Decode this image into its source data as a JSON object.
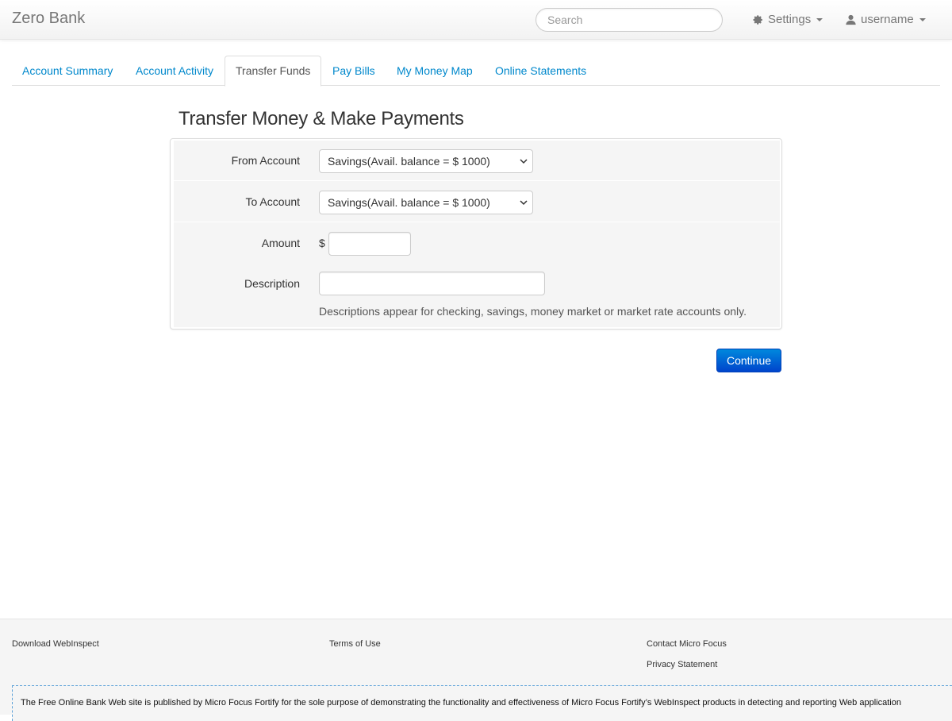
{
  "navbar": {
    "brand": "Zero Bank",
    "search_placeholder": "Search",
    "settings_label": "Settings",
    "user_label": "username"
  },
  "tabs": [
    {
      "label": "Account Summary",
      "active": false
    },
    {
      "label": "Account Activity",
      "active": false
    },
    {
      "label": "Transfer Funds",
      "active": true
    },
    {
      "label": "Pay Bills",
      "active": false
    },
    {
      "label": "My Money Map",
      "active": false
    },
    {
      "label": "Online Statements",
      "active": false
    }
  ],
  "main": {
    "title": "Transfer Money & Make Payments",
    "form": {
      "from_label": "From Account",
      "from_value": "Savings(Avail. balance = $ 1000)",
      "to_label": "To Account",
      "to_value": "Savings(Avail. balance = $ 1000)",
      "amount_label": "Amount",
      "currency_symbol": "$",
      "amount_value": "",
      "description_label": "Description",
      "description_value": "",
      "description_help": "Descriptions appear for checking, savings, money market or market rate accounts only."
    },
    "continue_label": "Continue"
  },
  "footer": {
    "download_webinspect": "Download WebInspect",
    "terms_of_use": "Terms of Use",
    "contact": "Contact Micro Focus",
    "privacy": "Privacy Statement",
    "disclaimer": "The Free Online Bank Web site is published by Micro Focus Fortify for the sole purpose of demonstrating the functionality and effectiveness of Micro Focus Fortify’s WebInspect products in detecting and reporting Web application"
  },
  "colors": {
    "link": "#0088cc",
    "button_top": "#0088dd",
    "button_bottom": "#0044cc"
  },
  "icons": {
    "settings": "gear-icon",
    "user": "user-icon",
    "dropdown": "caret-down-icon",
    "select": "chevron-down-icon"
  }
}
